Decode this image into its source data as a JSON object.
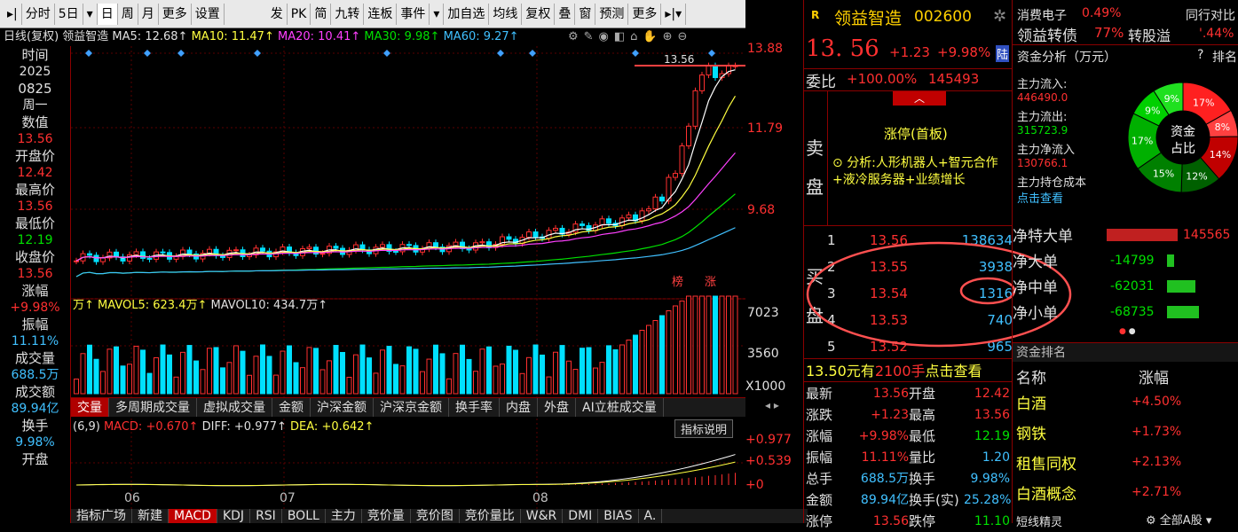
{
  "toolbar": {
    "items": [
      "分时",
      "5日",
      "日",
      "周",
      "月",
      "更多",
      "设置",
      "发",
      "PK",
      "简",
      "九转",
      "连板",
      "事件",
      "加自选",
      "均线",
      "复权",
      "叠",
      "窗",
      "预测",
      "更多"
    ],
    "active": "日"
  },
  "ma_row": {
    "label": "日线(复权) 领益智造",
    "ma5": "MA5: 12.68↑",
    "ma10": "MA10: 11.47↑",
    "ma20": "MA20: 10.41↑",
    "ma30": "MA30: 9.98↑",
    "ma60": "MA60: 9.27↑"
  },
  "left": {
    "labels": [
      {
        "l": "时间",
        "v": "2025"
      },
      {
        "l": "0825",
        "v": "周一"
      },
      {
        "l": "数值",
        "v": "13.56"
      },
      {
        "l": "开盘价",
        "v": "12.42"
      },
      {
        "l": "最高价",
        "v": "13.56"
      },
      {
        "l": "最低价",
        "v": "12.19"
      },
      {
        "l": "收盘价",
        "v": "13.56"
      },
      {
        "l": "涨幅",
        "v": "+9.98%"
      },
      {
        "l": "振幅",
        "v": "11.11%"
      },
      {
        "l": "成交量",
        "v": "688.5万"
      },
      {
        "l": "成交额",
        "v": "89.94亿"
      },
      {
        "l": "换手",
        "v": "9.98%"
      },
      {
        "l": "开盘",
        "v": ""
      }
    ]
  },
  "price_axis": {
    "p1": "13.88",
    "p2": "11.79",
    "p3": "9.68",
    "v1": "7023",
    "v2": "3560",
    "v3": "X1000",
    "m1": "+0.977",
    "m2": "+0.539",
    "m3": "+0"
  },
  "chart_labels": {
    "top_price": "13.56",
    "bang": "榜",
    "zhang": "涨",
    "months": [
      "06",
      "07",
      "08"
    ]
  },
  "vol_row": {
    "a": "万↑",
    "b": "MAVOL5: 623.4万↑",
    "c": "MAVOL10: 434.7万↑"
  },
  "macd_row": {
    "a": "(6,9)",
    "b": "MACD: +0.670↑",
    "c": "DIFF: +0.977↑",
    "d": "DEA: +0.642↑",
    "btn": "指标说明"
  },
  "tabs": [
    "交量",
    "多周期成交量",
    "虚拟成交量",
    "金额",
    "沪深金额",
    "沪深京金额",
    "换手率",
    "内盘",
    "外盘",
    "AI立桩成交量"
  ],
  "btabs": [
    "指标广场",
    "新建",
    "MACD",
    "KDJ",
    "RSI",
    "BOLL",
    "主力",
    "竞价量",
    "竞价图",
    "竞价量比",
    "W&R",
    "DMI",
    "BIAS",
    "A."
  ],
  "stock": {
    "badge": "R",
    "name": "领益智造",
    "code": "002600",
    "price": "13. 56",
    "chg": "+1.23",
    "pct": "+9.98%",
    "lu": "陆"
  },
  "weibi": {
    "label": "委比",
    "pct": "+100.00%",
    "num": "145493"
  },
  "sell": {
    "label1": "卖",
    "label2": "盘",
    "status": "涨停(首板)",
    "analysis": "分析:人形机器人+智元合作+液冷服务器+业绩增长"
  },
  "buy": {
    "label1": "买",
    "label2": "盘",
    "rows": [
      {
        "n": "1",
        "p": "13.56",
        "v": "138634"
      },
      {
        "n": "2",
        "p": "13.55",
        "v": "3938"
      },
      {
        "n": "3",
        "p": "13.54",
        "v": "1316"
      },
      {
        "n": "4",
        "p": "13.53",
        "v": "740"
      },
      {
        "n": "5",
        "p": "13.52",
        "v": "965"
      }
    ]
  },
  "notice": {
    "a": "13.50元有",
    "b": "2100手",
    "c": "点击查看"
  },
  "quote": [
    {
      "l1": "最新",
      "v1": "13.56",
      "l2": "开盘",
      "v2": "12.42"
    },
    {
      "l1": "涨跌",
      "v1": "+1.23",
      "l2": "最高",
      "v2": "13.56"
    },
    {
      "l1": "涨幅",
      "v1": "+9.98%",
      "l2": "最低",
      "v2": "12.19"
    },
    {
      "l1": "振幅",
      "v1": "11.11%",
      "l2": "量比",
      "v2": "1.20"
    },
    {
      "l1": "总手",
      "v1": "688.5万",
      "l2": "换手",
      "v2": "9.98%"
    },
    {
      "l1": "金额",
      "v1": "89.94亿",
      "l2": "换手(实)",
      "v2": "25.28%"
    },
    {
      "l1": "涨停",
      "v1": "13.56",
      "l2": "跌停",
      "v2": "11.10"
    }
  ],
  "sector": {
    "l1": "消费电子",
    "p1": "0.49%",
    "r1": "同行对比",
    "l2": "领益转债",
    "p2": "77%",
    "t2": "转股溢",
    "r2": "'.44%"
  },
  "fund": {
    "title": "资金分析（万元）",
    "q": "?",
    "rank": "排名",
    "in_label": "主力流入:",
    "in_val": "446490.0",
    "out_label": "主力流出:",
    "out_val": "315723.9",
    "net_label": "主力净流入",
    "net_val": "130766.1",
    "cost_label": "主力持仓成本",
    "cost_link": "点击查看",
    "pie_center1": "资金",
    "pie_center2": "占比",
    "pie": [
      {
        "pct": "17%",
        "v": 17,
        "c": "#ff2020"
      },
      {
        "pct": "8%",
        "v": 8,
        "c": "#ff4040"
      },
      {
        "pct": "14%",
        "v": 14,
        "c": "#c00000"
      },
      {
        "pct": "12%",
        "v": 12,
        "c": "#006000"
      },
      {
        "pct": "15%",
        "v": 15,
        "c": "#008000"
      },
      {
        "pct": "17%",
        "v": 17,
        "c": "#00b000"
      },
      {
        "pct": "9%",
        "v": 9,
        "c": "#00d000"
      },
      {
        "pct": "9%",
        "v": 9,
        "c": "#20e020"
      }
    ]
  },
  "orders": [
    {
      "l": "净特大单",
      "v": "145565",
      "c": "#ff3030",
      "w": 80
    },
    {
      "l": "净大单",
      "v": "-14799",
      "c": "#00e000",
      "w": 8
    },
    {
      "l": "净中单",
      "v": "-62031",
      "c": "#00e000",
      "w": 32
    },
    {
      "l": "净小单",
      "v": "-68735",
      "c": "#00e000",
      "w": 36
    }
  ],
  "ranking": {
    "title": "资金排名",
    "h1": "名称",
    "h2": "涨幅",
    "rows": [
      {
        "n": "白酒",
        "p": "+4.50%"
      },
      {
        "n": "钢铁",
        "p": "+1.73%"
      },
      {
        "n": "租售同权",
        "p": "+2.13%"
      },
      {
        "n": "白酒概念",
        "p": "+2.71%"
      }
    ]
  },
  "bottom_right": {
    "a": "短线精灵",
    "b": "全部A股"
  },
  "colors": {
    "up": "#ff3030",
    "down": "#00e0ff",
    "bg": "#000000",
    "border": "#8b0000"
  }
}
